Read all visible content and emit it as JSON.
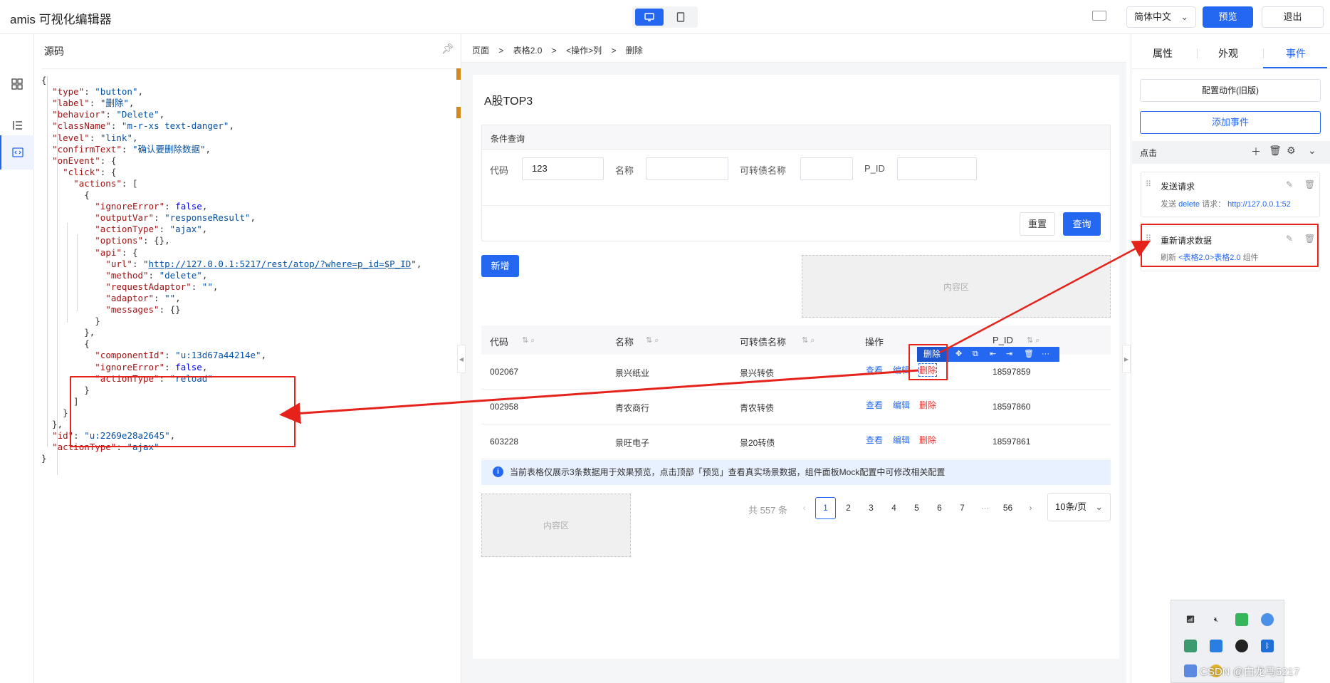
{
  "app": {
    "title": "amis 可视化编辑器"
  },
  "topbar": {
    "lang": "简体中文",
    "preview": "预览",
    "exit": "退出"
  },
  "code_panel": {
    "title": "源码",
    "lines": [
      "{",
      "  \"type\": \"button\",",
      "  \"label\": \"删除\",",
      "  \"behavior\": \"Delete\",",
      "  \"className\": \"m-r-xs text-danger\",",
      "  \"level\": \"link\",",
      "  \"confirmText\": \"确认要删除数据\",",
      "  \"onEvent\": {",
      "    \"click\": {",
      "      \"actions\": [",
      "        {",
      "          \"ignoreError\": false,",
      "          \"outputVar\": \"responseResult\",",
      "          \"actionType\": \"ajax\",",
      "          \"options\": {},",
      "          \"api\": {",
      "            \"url\": \"http://127.0.0.1:5217/rest/atop/?where=p_id=$P_ID\",",
      "            \"method\": \"delete\",",
      "            \"requestAdaptor\": \"\",",
      "            \"adaptor\": \"\",",
      "            \"messages\": {}",
      "          }",
      "        },",
      "        {",
      "          \"componentId\": \"u:13d67a44214e\",",
      "          \"ignoreError\": false,",
      "          \"actionType\": \"reload\"",
      "        }",
      "      ]",
      "    }",
      "  },",
      "  \"id\": \"u:2269e28a2645\",",
      "  \"actionType\": \"ajax\"",
      "}"
    ]
  },
  "breadcrumb": [
    "页面",
    ">",
    "表格2.0",
    ">",
    "<操作>列",
    ">",
    "删除"
  ],
  "page": {
    "title": "A股TOP3",
    "filter": {
      "heading": "条件查询",
      "fields": [
        {
          "label": "代码",
          "value": "123"
        },
        {
          "label": "名称",
          "value": ""
        },
        {
          "label": "可转债名称",
          "value": ""
        },
        {
          "label": "P_ID",
          "value": ""
        }
      ],
      "reset": "重置",
      "query": "查询"
    },
    "add_button": "新增",
    "content_zone": "内容区",
    "table": {
      "columns": [
        "代码",
        "名称",
        "可转债名称",
        "操作",
        "P_ID"
      ],
      "rows": [
        {
          "code": "002067",
          "name": "景兴纸业",
          "bond": "景兴转债",
          "pid": "18597859"
        },
        {
          "code": "002958",
          "name": "青农商行",
          "bond": "青农转债",
          "pid": "18597860"
        },
        {
          "code": "603228",
          "name": "景旺电子",
          "bond": "景20转债",
          "pid": "18597861"
        }
      ],
      "ops": {
        "view": "查看",
        "edit": "编辑",
        "delete": "删除"
      },
      "selected_label": "删除"
    },
    "info": "当前表格仅展示3条数据用于效果预览，点击顶部「预览」查看真实场景数据，组件面板Mock配置中可修改相关配置",
    "pagination": {
      "total": "共 557 条",
      "pages": [
        "1",
        "2",
        "3",
        "4",
        "5",
        "6",
        "7",
        "···",
        "56"
      ],
      "current": "1",
      "size": "10条/页"
    }
  },
  "right_panel": {
    "tabs": [
      "属性",
      "外观",
      "事件"
    ],
    "config_action": "配置动作(旧版)",
    "add_event": "添加事件",
    "event_name": "点击",
    "actions": [
      {
        "title": "发送请求",
        "desc_prefix": "发送",
        "desc_hl1": "delete",
        "desc_mid": "请求：",
        "desc_hl2": "http://127.0.0.1:52"
      },
      {
        "title": "重新请求数据",
        "desc_prefix": "刷新",
        "desc_hl1": "<表格2.0>表格2.0",
        "desc_mid": "组件",
        "desc_hl2": ""
      }
    ]
  },
  "watermark": "CSDN @白龙马5217",
  "colors": {
    "primary": "#2468f2",
    "danger": "#e53935",
    "annotation": "#e5231b"
  }
}
